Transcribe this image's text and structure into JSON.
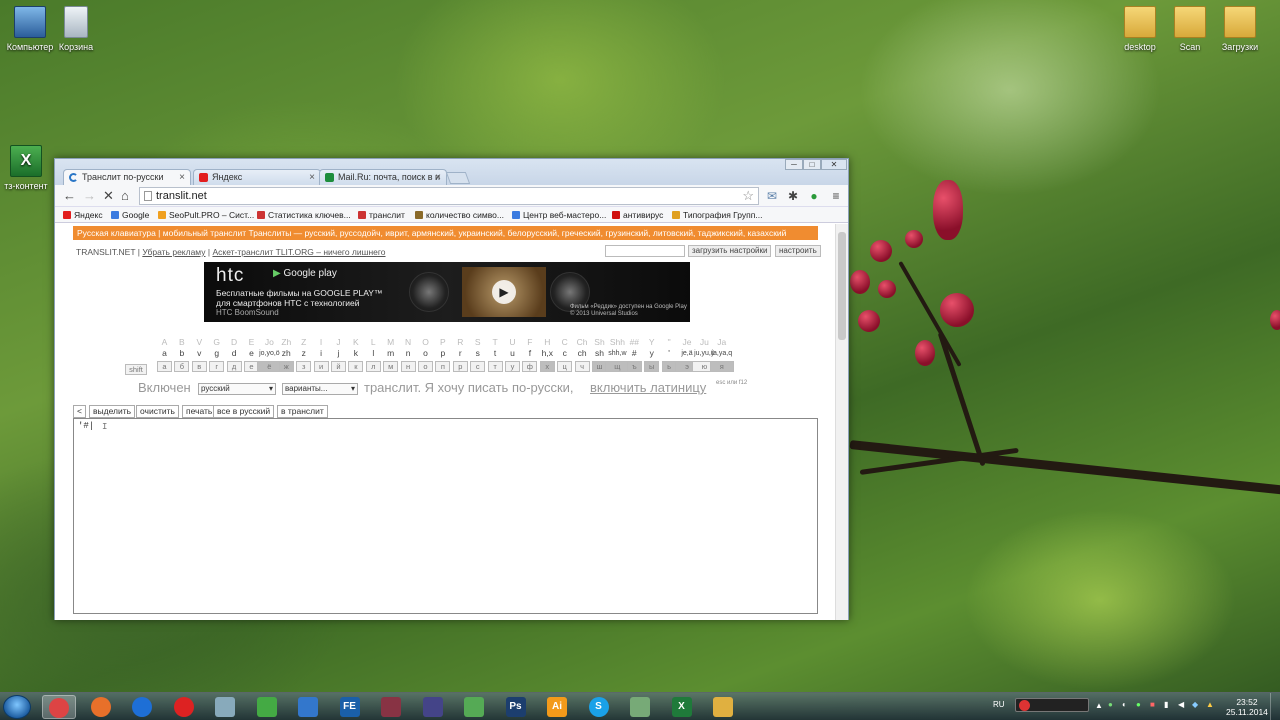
{
  "desktop": {
    "icons": [
      {
        "label": "Компьютер",
        "kind": "pc"
      },
      {
        "label": "Корзина",
        "kind": "trash"
      },
      {
        "label": "тз-контент",
        "kind": "xls"
      },
      {
        "label": "desktop",
        "kind": "folder"
      },
      {
        "label": "Scan",
        "kind": "folder"
      },
      {
        "label": "Загрузки",
        "kind": "folder"
      }
    ]
  },
  "browser": {
    "tabs": [
      {
        "title": "Транслит по-русски",
        "close": "×",
        "favicon_color": "#2a76c6"
      },
      {
        "title": "Яндекс",
        "close": "×",
        "favicon_color": "#e21e1e"
      },
      {
        "title": "Mail.Ru: почта, поиск в и",
        "close": "×",
        "favicon_color": "#1d8d3c"
      }
    ],
    "window_controls": {
      "minimize": "─",
      "maximize": "□",
      "close": "✕"
    },
    "nav": {
      "back": "←",
      "forward": "→",
      "stop": "✕",
      "home": "⌂"
    },
    "url": "translit.net",
    "toolbar_icons": {
      "star": "☆",
      "ext1": "✉",
      "settings": "✱",
      "ext2": "●",
      "menu": "≡"
    },
    "bookmarks": [
      {
        "label": "Яндекс",
        "color": "#e21e1e"
      },
      {
        "label": "Google",
        "color": "#3b7be0"
      },
      {
        "label": "SeoPult.PRO – Сист...",
        "color": "#f0a020"
      },
      {
        "label": "Статистика ключев...",
        "color": "#c33"
      },
      {
        "label": "транслит",
        "color": "#c33"
      },
      {
        "label": "количество симво...",
        "color": "#8a6a2a"
      },
      {
        "label": "Центр веб-мастеро...",
        "color": "#3b7be0"
      },
      {
        "label": "антивирус",
        "color": "#d01010"
      },
      {
        "label": "Типография Групп...",
        "color": "#e0a020"
      }
    ]
  },
  "page": {
    "orange_bar": "Русская клавиатура | мобильный транслит   Транслиты — русский, руссодойч, иврит, армянский, украинский, белорусский, греческий, грузинский, литовский, таджикский, казахский",
    "line2": {
      "site": "TRANSLIT.NET |",
      "ads": "Убрать рекламу",
      "sep": "|",
      "ascet": "Аскет-транслит TLIT.ORG – ничего лишнего"
    },
    "load_settings": "загрузить настройки",
    "configure": "настроить",
    "banner": {
      "brand": "htc",
      "store": "Google play",
      "line1": "Бесплатные фильмы на GOOGLE PLAY™",
      "line2": "для смартфонов HTC с технологией",
      "line3": "HTC BoomSound",
      "play": "▶",
      "caption": "Фильм «Реддик» доступен на Google Play © 2013 Universal Studios"
    },
    "keyboard": [
      {
        "lat": "A",
        "lat2": "a",
        "key": "а"
      },
      {
        "lat": "B",
        "lat2": "b",
        "key": "б"
      },
      {
        "lat": "V",
        "lat2": "v",
        "key": "в"
      },
      {
        "lat": "G",
        "lat2": "g",
        "key": "г"
      },
      {
        "lat": "D",
        "lat2": "d",
        "key": "д"
      },
      {
        "lat": "E",
        "lat2": "e",
        "key": "е"
      },
      {
        "lat": "Jo",
        "lat2": "jo,yo,ö",
        "key": "ё",
        "dark": true
      },
      {
        "lat": "Zh",
        "lat2": "zh",
        "key": "ж",
        "dark": true
      },
      {
        "lat": "Z",
        "lat2": "z",
        "key": "з"
      },
      {
        "lat": "I",
        "lat2": "i",
        "key": "и"
      },
      {
        "lat": "J",
        "lat2": "j",
        "key": "й"
      },
      {
        "lat": "K",
        "lat2": "k",
        "key": "к"
      },
      {
        "lat": "L",
        "lat2": "l",
        "key": "л"
      },
      {
        "lat": "M",
        "lat2": "m",
        "key": "м"
      },
      {
        "lat": "N",
        "lat2": "n",
        "key": "н"
      },
      {
        "lat": "O",
        "lat2": "o",
        "key": "о"
      },
      {
        "lat": "P",
        "lat2": "p",
        "key": "п"
      },
      {
        "lat": "R",
        "lat2": "r",
        "key": "р"
      },
      {
        "lat": "S",
        "lat2": "s",
        "key": "с"
      },
      {
        "lat": "T",
        "lat2": "t",
        "key": "т"
      },
      {
        "lat": "U",
        "lat2": "u",
        "key": "у"
      },
      {
        "lat": "F",
        "lat2": "f",
        "key": "ф"
      },
      {
        "lat": "H",
        "lat2": "h,x",
        "key": "х",
        "dark": true
      },
      {
        "lat": "C",
        "lat2": "c",
        "key": "ц"
      },
      {
        "lat": "Ch",
        "lat2": "ch",
        "key": "ч"
      },
      {
        "lat": "Sh",
        "lat2": "sh",
        "key": "ш",
        "dark": true
      },
      {
        "lat": "Shh",
        "lat2": "shh,w",
        "key": "щ",
        "dark": true
      },
      {
        "lat": "##",
        "lat2": "#",
        "key": "ъ",
        "dark": true
      },
      {
        "lat": "Y",
        "lat2": "y",
        "key": "ы",
        "dark": true
      },
      {
        "lat": "''",
        "lat2": "'",
        "key": "ь",
        "dark": true
      },
      {
        "lat": "Je",
        "lat2": "je,ä",
        "key": "э",
        "dark": true
      },
      {
        "lat": "Ju",
        "lat2": "ju,yu,ü",
        "key": "ю"
      },
      {
        "lat": "Ja",
        "lat2": "ja,ya,q",
        "key": "я",
        "dark": true
      }
    ],
    "shift": "shift",
    "mode": {
      "enabled": "Включен",
      "lang": "русский",
      "variants": "варианты...",
      "text": "транслит. Я хочу писать по-русски,",
      "switch": "включить латиницу",
      "hint": "esc или f12"
    },
    "editor_buttons": [
      "<",
      "выделить",
      "очистить",
      "печать",
      "все в русский",
      "в транслит"
    ],
    "textarea": "'#|"
  },
  "taskbar": {
    "apps": [
      {
        "name": "chrome",
        "label": "",
        "active": true
      },
      {
        "name": "firefox",
        "label": ""
      },
      {
        "name": "teamviewer",
        "label": ""
      },
      {
        "name": "opera",
        "label": ""
      },
      {
        "name": "notepad",
        "label": ""
      },
      {
        "name": "utorrent",
        "label": ""
      },
      {
        "name": "monitor",
        "label": ""
      },
      {
        "name": "fe",
        "label": "FE"
      },
      {
        "name": "winrar",
        "label": ""
      },
      {
        "name": "save",
        "label": ""
      },
      {
        "name": "ooo",
        "label": ""
      },
      {
        "name": "photoshop",
        "label": "Ps"
      },
      {
        "name": "illustrator",
        "label": "Ai"
      },
      {
        "name": "skype",
        "label": "S"
      },
      {
        "name": "ppt",
        "label": ""
      },
      {
        "name": "excel",
        "label": "X"
      },
      {
        "name": "explorer",
        "label": ""
      }
    ],
    "lang": "RU",
    "time": "23:52",
    "date": "25.11.2014"
  }
}
